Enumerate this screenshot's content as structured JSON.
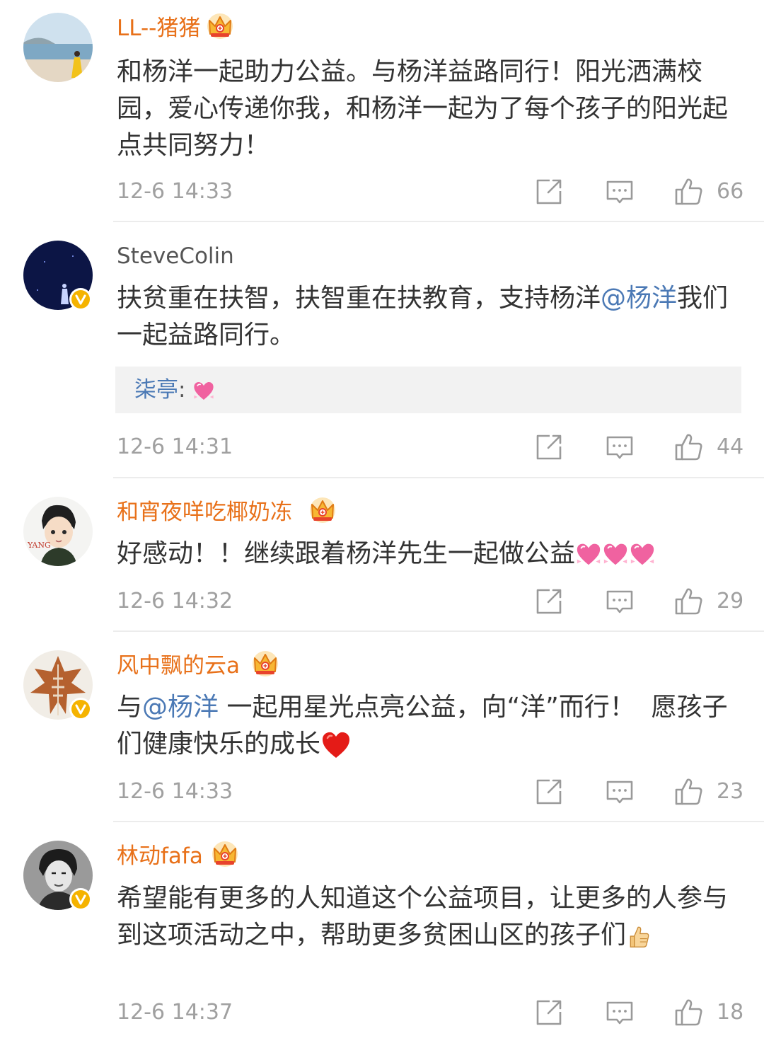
{
  "colors": {
    "vip_name": "#e8711a",
    "normal_name": "#555555",
    "link": "#4b79b5",
    "meta_gray": "#a0a0a0",
    "verified_badge": "#f5b300"
  },
  "icons": {
    "repost": "share-square-icon",
    "comment": "comment-bubble-icon",
    "like": "thumbs-up-icon",
    "vip": "crown-icon",
    "verified": "verified-v-badge-icon"
  },
  "comments": [
    {
      "username": "LL--猪猪",
      "vip": true,
      "verified": false,
      "text": "和杨洋一起助力公益。与杨洋益路同行！阳光洒满校园，爱心传递你我，和杨洋一起为了每个孩子的阳光起点共同努力！",
      "time": "12-6 14:33",
      "likes": "66"
    },
    {
      "username": "SteveColin",
      "vip": false,
      "verified": true,
      "text_before": "扶贫重在扶智，扶智重在扶教育，支持杨洋",
      "mention": "@杨洋",
      "text_after": "我们一起益路同行。",
      "reply_user": "柒亭",
      "reply_colon": ": ",
      "time": "12-6 14:31",
      "likes": "44"
    },
    {
      "username": "和宵夜咩吃椰奶冻",
      "vip": true,
      "verified": false,
      "text": "好感动！！继续跟着杨洋先生一起做公益",
      "avatar_text": "YANG",
      "time": "12-6 14:32",
      "likes": "29"
    },
    {
      "username": "风中飘的云a",
      "vip": true,
      "verified": true,
      "text_before": "与",
      "mention": "@杨洋",
      "text_after": " 一起用星光点亮公益，向“洋”而行！  愿孩子们健康快乐的成长",
      "time": "12-6 14:33",
      "likes": "23"
    },
    {
      "username": "林动fafa",
      "vip": true,
      "verified": true,
      "text": "希望能有更多的人知道这个公益项目，让更多的人参与到这项活动之中，帮助更多贫困山区的孩子们",
      "time": "12-6 14:37",
      "likes": "18"
    }
  ]
}
